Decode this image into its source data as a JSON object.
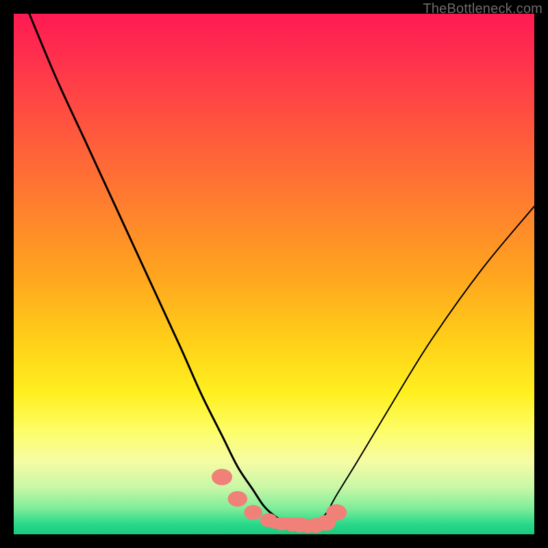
{
  "watermark": "TheBottleneck.com",
  "chart_data": {
    "type": "line",
    "title": "",
    "xlabel": "",
    "ylabel": "",
    "xlim": [
      0,
      100
    ],
    "ylim": [
      0,
      100
    ],
    "legend": false,
    "grid": false,
    "background": "red-yellow-green-vertical-gradient",
    "series": [
      {
        "name": "left-curve",
        "color": "#000000",
        "x": [
          3,
          8,
          14,
          20,
          26,
          32,
          36,
          40,
          43,
          46,
          48,
          50,
          52,
          54,
          56
        ],
        "y": [
          100,
          88,
          75,
          62,
          49,
          36,
          27,
          19,
          13,
          8.5,
          5.5,
          3.6,
          2.4,
          1.8,
          1.6
        ]
      },
      {
        "name": "right-curve",
        "color": "#000000",
        "x": [
          56,
          58,
          60,
          62,
          66,
          72,
          80,
          90,
          100
        ],
        "y": [
          1.6,
          2.2,
          4.0,
          7.5,
          14,
          24,
          37,
          51,
          63
        ]
      },
      {
        "name": "marker-band",
        "color": "#f08078",
        "kind": "scatter",
        "x": [
          40,
          43,
          46,
          49,
          51.5,
          53.5,
          55,
          56.5,
          58,
          60,
          62
        ],
        "y": [
          11,
          6.8,
          4.2,
          2.7,
          2.0,
          1.7,
          1.6,
          1.6,
          1.7,
          2.2,
          4.2
        ]
      }
    ]
  }
}
